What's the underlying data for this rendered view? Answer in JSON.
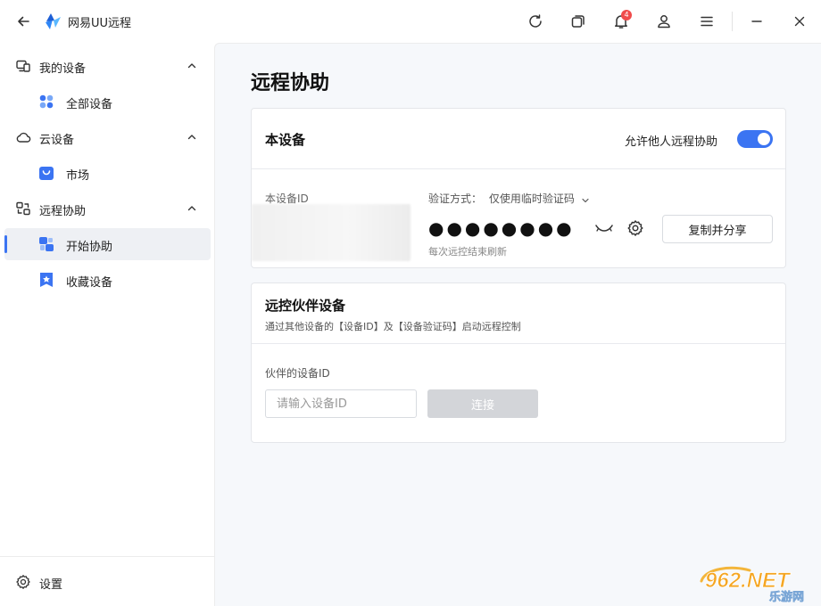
{
  "app": {
    "title": "网易UU远程"
  },
  "titlebar": {
    "notification_count": "4"
  },
  "sidebar": {
    "groups": [
      {
        "label": "我的设备",
        "items": [
          {
            "label": "全部设备"
          }
        ]
      },
      {
        "label": "云设备",
        "items": [
          {
            "label": "市场"
          }
        ]
      },
      {
        "label": "远程协助",
        "items": [
          {
            "label": "开始协助"
          },
          {
            "label": "收藏设备"
          }
        ]
      }
    ],
    "settings_label": "设置"
  },
  "main": {
    "page_title": "远程协助",
    "this_device": {
      "title": "本设备",
      "allow_label": "允许他人远程协助",
      "allow_enabled": true,
      "device_id_label": "本设备ID",
      "verify_method_label": "验证方式：",
      "verify_method_value": "仅使用临时验证码",
      "password_mask": "●●●●●●●●",
      "refresh_note": "每次远控结束刷新",
      "copy_share_label": "复制并分享"
    },
    "partner_device": {
      "title": "远控伙伴设备",
      "description": "通过其他设备的【设备ID】及【设备验证码】启动远程控制",
      "id_label": "伙伴的设备ID",
      "id_placeholder": "请输入设备ID",
      "connect_label": "连接"
    }
  },
  "watermark": {
    "text_top": "962.NET",
    "text_bottom": "乐游网"
  },
  "colors": {
    "accent": "#3b74f2",
    "badge": "#f04b4b",
    "disabled_button": "#d3d5d9"
  }
}
